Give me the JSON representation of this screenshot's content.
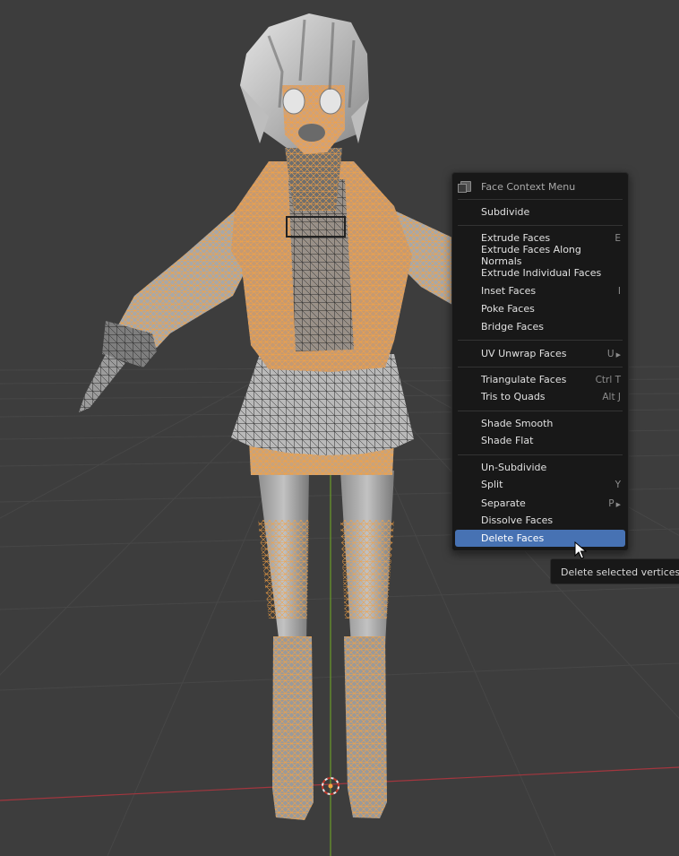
{
  "menu": {
    "title": "Face Context Menu",
    "icon": "face-mode-icon",
    "items": [
      {
        "label": "Subdivide",
        "shortcut": ""
      },
      {
        "label": "Extrude Faces",
        "shortcut": "E"
      },
      {
        "label": "Extrude Faces Along Normals",
        "shortcut": ""
      },
      {
        "label": "Extrude Individual Faces",
        "shortcut": ""
      },
      {
        "label": "Inset Faces",
        "shortcut": "I"
      },
      {
        "label": "Poke Faces",
        "shortcut": ""
      },
      {
        "label": "Bridge Faces",
        "shortcut": ""
      },
      {
        "label": "UV Unwrap Faces",
        "shortcut": "U"
      },
      {
        "label": "Triangulate Faces",
        "shortcut": "Ctrl T"
      },
      {
        "label": "Tris to Quads",
        "shortcut": "Alt J"
      },
      {
        "label": "Shade Smooth",
        "shortcut": ""
      },
      {
        "label": "Shade Flat",
        "shortcut": ""
      },
      {
        "label": "Un-Subdivide",
        "shortcut": ""
      },
      {
        "label": "Split",
        "shortcut": "Y"
      },
      {
        "label": "Separate",
        "shortcut": "P"
      },
      {
        "label": "Dissolve Faces",
        "shortcut": ""
      },
      {
        "label": "Delete Faces",
        "shortcut": ""
      }
    ]
  },
  "tooltip": {
    "text": "Delete selected vertices, e"
  },
  "colors": {
    "viewport_bg": "#3d3d3d",
    "selection_orange": "#f5a142",
    "menu_bg": "#181818",
    "highlight": "#4772b3",
    "axis_x": "#a3363e",
    "axis_y": "#6b9c2a"
  }
}
